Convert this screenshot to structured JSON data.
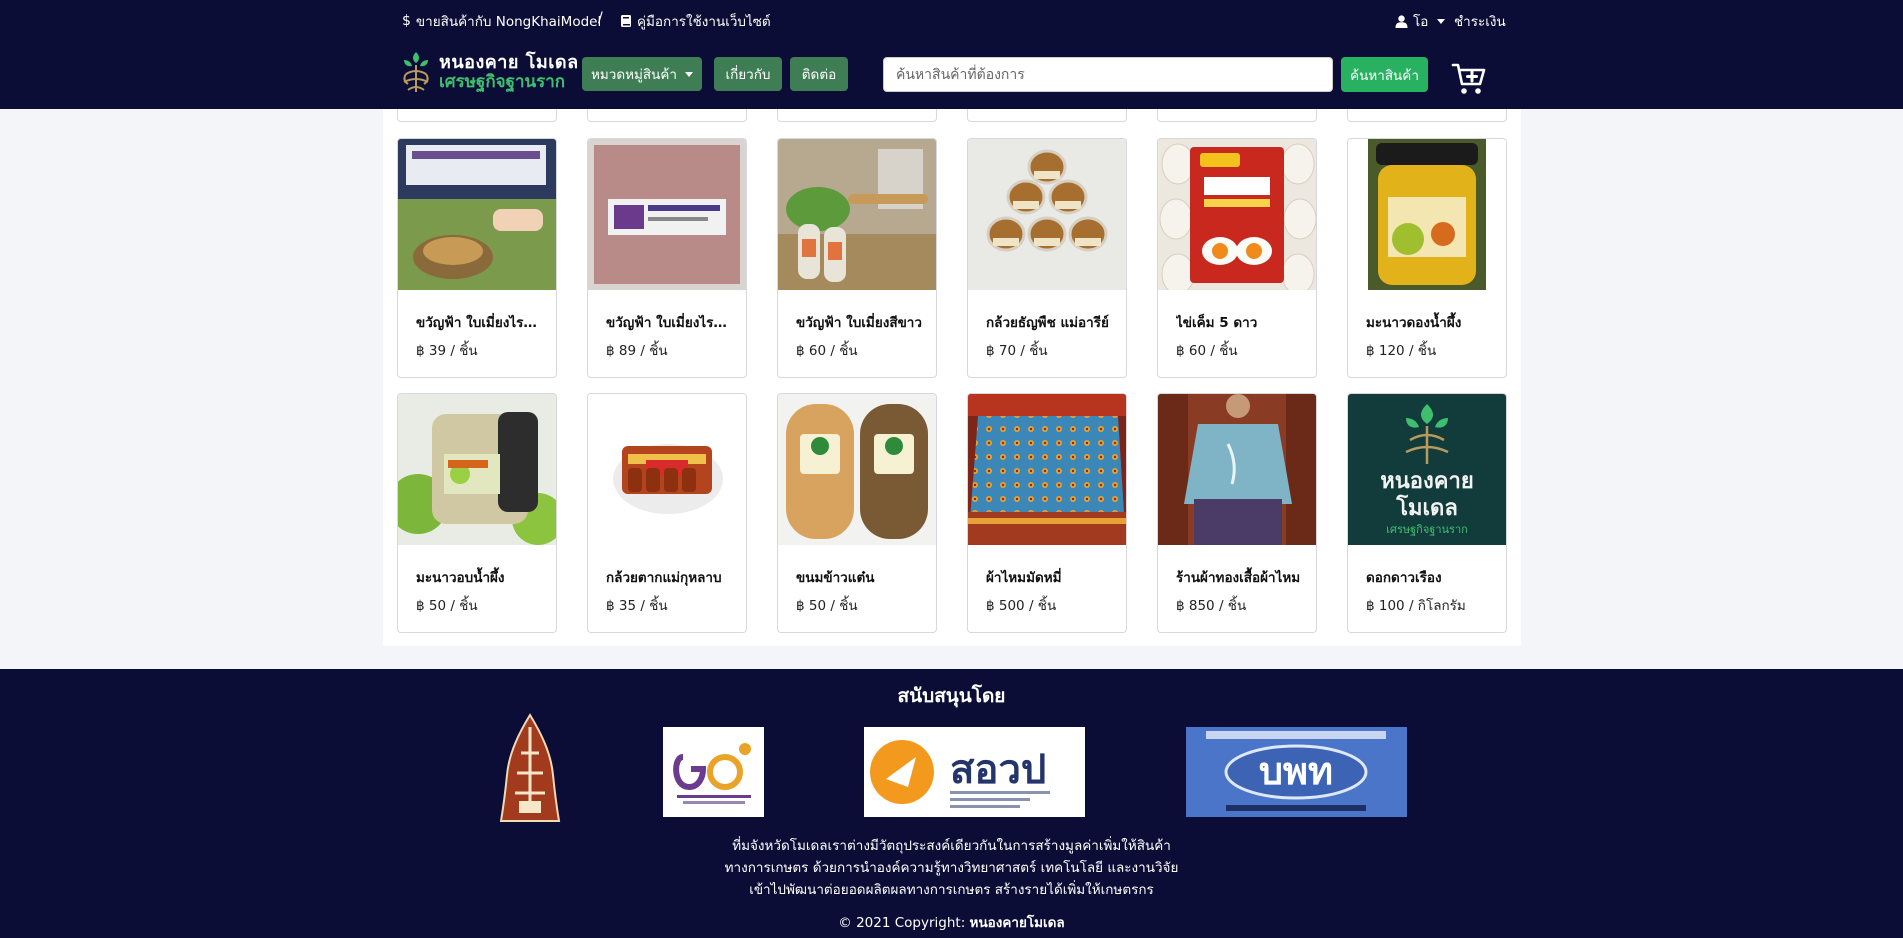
{
  "topbar": {
    "sell_link": "ขายสินค้ากับ NongKhaiModel",
    "separator": "/",
    "manual_link": "คู่มือการใช้งานเว็บไซต์",
    "user_name": "โอ",
    "checkout": "ชำระเงิน"
  },
  "logo": {
    "line1": "หนองคาย โมเดล",
    "line2": "เศรษฐกิจฐานราก"
  },
  "nav": {
    "categories": "หมวดหมู่สินค้า",
    "about": "เกี่ยวกับ",
    "contact": "ติดต่อ"
  },
  "search": {
    "placeholder": "ค้นหาสินค้าที่ต้องการ",
    "button": "ค้นหาสินค้า"
  },
  "products": [
    {
      "name": "ขวัญฟ้า ใบเมี่ยงไรซ์เบอร์รี่",
      "price": "฿ 39 / ชิ้น"
    },
    {
      "name": "ขวัญฟ้า ใบเมี่ยงไรซ์เบอร์รี่",
      "price": "฿ 89 / ชิ้น"
    },
    {
      "name": "ขวัญฟ้า ใบเมี่ยงสีขาว",
      "price": "฿ 60 / ชิ้น"
    },
    {
      "name": "กล้วยธัญพืช แม่อารีย์",
      "price": "฿ 70 / ชิ้น"
    },
    {
      "name": "ไข่เค็ม 5 ดาว",
      "price": "฿ 60 / ชิ้น"
    },
    {
      "name": "มะนาวดองน้ำผึ้ง",
      "price": "฿ 120 / ชิ้น"
    },
    {
      "name": "มะนาวอบน้ำผึ้ง",
      "price": "฿ 50 / ชิ้น"
    },
    {
      "name": "กล้วยตากแม่กุหลาบ",
      "price": "฿ 35 / ชิ้น"
    },
    {
      "name": "ขนมข้าวแต๋น",
      "price": "฿ 50 / ชิ้น"
    },
    {
      "name": "ผ้าไหมมัดหมี่",
      "price": "฿ 500 / ชิ้น"
    },
    {
      "name": "ร้านผ้าทองเสื้อผ้าไหม",
      "price": "฿ 850 / ชิ้น"
    },
    {
      "name": "ดอกดาวเรือง",
      "price": "฿ 100 / กิโลกรัม"
    }
  ],
  "product_image_text": {
    "logo_line1": "หนองคาย",
    "logo_line2": "โมเดล",
    "logo_line3": "เศรษฐกิจฐานราก"
  },
  "footer": {
    "title": "สนับสนุนโดย",
    "sponsor3_name": "สอวป",
    "sponsor4_name": "บพท",
    "line1": "ที่มจังหวัดโมเดลเราต่างมีวัตถุประสงค์เดียวกันในการสร้างมูลค่าเพิ่มให้สินค้า",
    "line2": "ทางการเกษตร ด้วยการนำองค์ความรู้ทางวิทยาศาสตร์ เทคโนโลยี และงานวิจัย",
    "line3": "เข้าไปพัฒนาต่อยอดผลิตผลทางการเกษตร สร้างรายได้เพิ่มให้เกษตรกร",
    "copyright_prefix": "© 2021 Copyright:",
    "copyright_name": "หนองคายโมเดล"
  },
  "colors": {
    "navbar": "#0b0d36",
    "nav_button": "#3f7e55",
    "search_button": "#28b160"
  }
}
